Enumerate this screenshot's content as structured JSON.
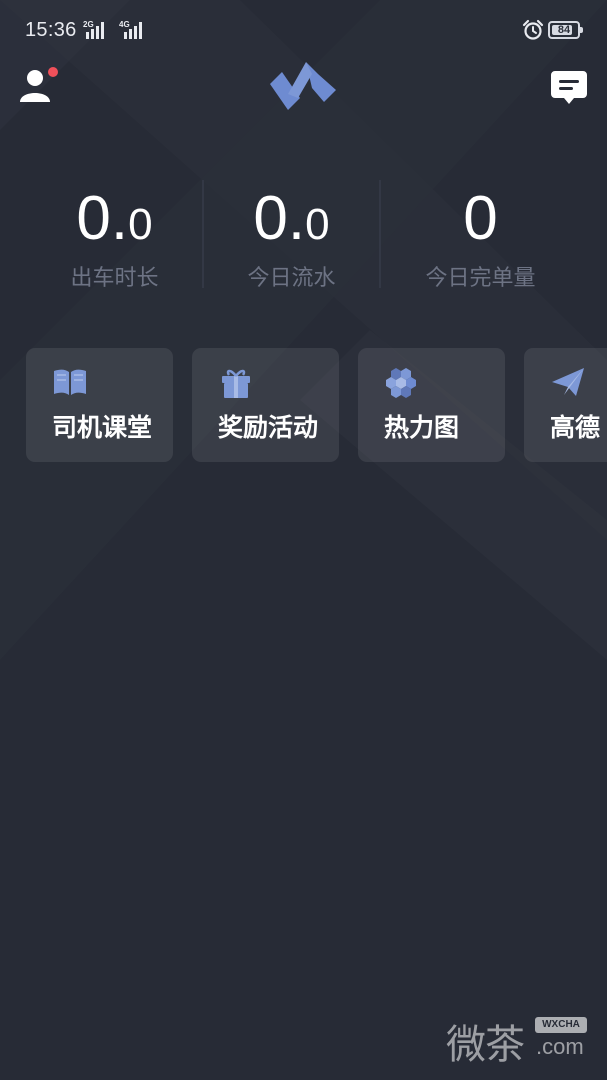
{
  "status_bar": {
    "time": "15:36",
    "signal_1": "2G",
    "signal_2": "4G",
    "alarm_icon": "alarm-clock-icon",
    "battery_percent": "84",
    "battery_level": 0.84
  },
  "header": {
    "user_icon": "user-icon",
    "has_notification_dot": true,
    "logo_icon": "chevron-logo-icon",
    "message_icon": "message-icon"
  },
  "stats": [
    {
      "value_int": "0.",
      "value_frac": "0",
      "label": "出车时长"
    },
    {
      "value_int": "0.",
      "value_frac": "0",
      "label": "今日流水"
    },
    {
      "value_int": "0",
      "value_frac": "",
      "label": "今日完单量"
    }
  ],
  "cards": [
    {
      "label": "司机课堂",
      "icon": "book-icon"
    },
    {
      "label": "奖励活动",
      "icon": "gift-icon"
    },
    {
      "label": "热力图",
      "icon": "hexagon-cluster-icon"
    },
    {
      "label": "高德",
      "icon": "paper-plane-icon"
    }
  ],
  "watermark": {
    "text": "微茶",
    "badge": "WXCHA",
    "domain": ".com"
  },
  "colors": {
    "background": "#272b36",
    "accent": "#7d98d6",
    "label_gray": "#6d7384",
    "notification": "#f0505a"
  }
}
